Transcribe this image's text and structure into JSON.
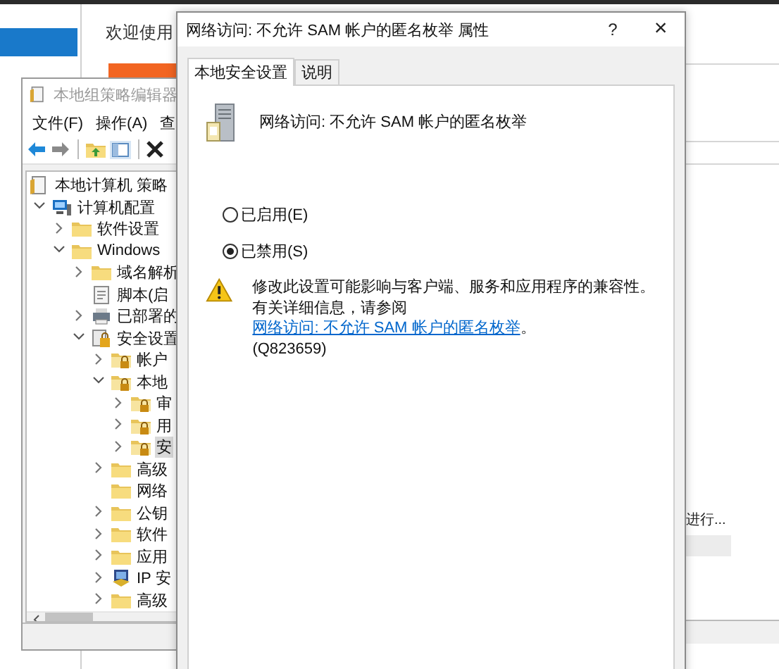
{
  "background_window": {
    "sidebar": {
      "items": [
        {
          "selected": true
        }
      ]
    },
    "welcome": "欢迎使用",
    "status_text": "进行..."
  },
  "editor": {
    "title": "本地组策略编辑器",
    "menu": [
      "文件(F)",
      "操作(A)",
      "查"
    ],
    "tree": [
      {
        "label": "本地计算机 策略",
        "kind": "policy",
        "selected": false,
        "children": [
          {
            "label": "计算机配置",
            "kind": "computer",
            "expanded": true,
            "selected": false,
            "children": [
              {
                "label": "软件设置",
                "kind": "folder",
                "expanded": false,
                "selected": false
              },
              {
                "label": "Windows",
                "kind": "folder",
                "expanded": true,
                "selected": false,
                "children": [
                  {
                    "label": "域名解析",
                    "kind": "folder",
                    "expanded": false,
                    "selected": false
                  },
                  {
                    "label": "脚本(启",
                    "kind": "script",
                    "selected": false
                  },
                  {
                    "label": "已部署的",
                    "kind": "printer",
                    "expanded": false,
                    "selected": false
                  },
                  {
                    "label": "安全设置",
                    "kind": "security",
                    "expanded": true,
                    "selected": false,
                    "children": [
                      {
                        "label": "帐户",
                        "kind": "lock-folder",
                        "expanded": false,
                        "selected": false
                      },
                      {
                        "label": "本地",
                        "kind": "lock-folder",
                        "expanded": true,
                        "selected": false,
                        "children": [
                          {
                            "label": "审",
                            "kind": "lock-folder",
                            "expanded": false,
                            "selected": false
                          },
                          {
                            "label": "用",
                            "kind": "lock-folder",
                            "expanded": false,
                            "selected": false
                          },
                          {
                            "label": "安",
                            "kind": "lock-folder",
                            "expanded": false,
                            "selected": true
                          }
                        ]
                      },
                      {
                        "label": "高级",
                        "kind": "folder",
                        "expanded": false,
                        "selected": false
                      },
                      {
                        "label": "网络",
                        "kind": "folder",
                        "selected": false
                      },
                      {
                        "label": "公钥",
                        "kind": "folder",
                        "expanded": false,
                        "selected": false
                      },
                      {
                        "label": "软件",
                        "kind": "folder",
                        "expanded": false,
                        "selected": false
                      },
                      {
                        "label": "应用",
                        "kind": "folder",
                        "expanded": false,
                        "selected": false
                      },
                      {
                        "label": "IP 安",
                        "kind": "ip",
                        "expanded": false,
                        "selected": false
                      },
                      {
                        "label": "高级",
                        "kind": "folder",
                        "expanded": false,
                        "selected": false
                      }
                    ]
                  }
                ]
              }
            ]
          }
        ]
      }
    ]
  },
  "dialog": {
    "title": "网络访问: 不允许 SAM 帐户的匿名枚举 属性",
    "help": "?",
    "close": "×",
    "tabs": [
      {
        "label": "本地安全设置",
        "selected": true
      },
      {
        "label": "说明",
        "selected": false
      }
    ],
    "policy_name": "网络访问: 不允许 SAM 帐户的匿名枚举",
    "options": [
      {
        "label": "已启用(E)",
        "selected": false
      },
      {
        "label": "已禁用(S)",
        "selected": true
      }
    ],
    "warning": {
      "line1": "修改此设置可能影响与客户端、服务和应用程序的兼容性。",
      "before_link": "有关详细信息，请参阅",
      "link": "网络访问: 不允许 SAM 帐户的匿名枚举",
      "after_link": "。",
      "code": "(Q823659)"
    }
  }
}
